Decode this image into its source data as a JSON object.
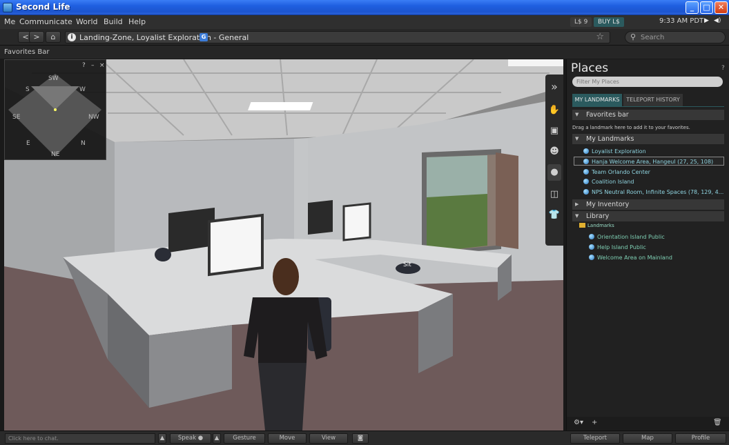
{
  "window": {
    "title": "Second Life",
    "minimize": "_",
    "maximize": "□",
    "close": "✕"
  },
  "menubar": {
    "items": [
      "Me",
      "Communicate",
      "World",
      "Build",
      "Help"
    ],
    "balance": "L$ 9",
    "buy": "BUY L$",
    "time": "9:33 AM PDT",
    "media": "▶",
    "volume": "◀)"
  },
  "navbar": {
    "back": "<",
    "forward": ">",
    "home": "⌂",
    "info": "i",
    "location": "Landing-Zone, Loyalist Exploration - General",
    "region_badge": "G",
    "star": "☆",
    "search_placeholder": "Search"
  },
  "favorites_bar": {
    "label": "Favorites Bar"
  },
  "minimap": {
    "help": "?",
    "minimize": "–",
    "close": "×",
    "directions": {
      "sw": "SW",
      "s": "S",
      "w": "W",
      "se": "SE",
      "nw": "NW",
      "e": "E",
      "n": "N",
      "ne": "NE"
    }
  },
  "scene": {
    "sit_label": "Sit"
  },
  "sidetools": {
    "collapse": "»"
  },
  "places": {
    "title": "Places",
    "help": "?",
    "filter_placeholder": "Filter My Places",
    "tabs": {
      "landmarks": "MY LANDMARKS",
      "history": "TELEPORT HISTORY"
    },
    "favorites": {
      "label": "Favorites bar",
      "arrow": "▼"
    },
    "hint": "Drag a landmark here to add it to your favorites.",
    "my_landmarks": {
      "label": "My Landmarks",
      "arrow": "▼",
      "items": [
        "Loyalist Exploration",
        "Hanja  Welcome Area, Hangeul (27, 25, 108)",
        "Team Orlando Center",
        "Coalition Island",
        "NPS Neutral Room, Infinite Spaces (78, 129, 4..."
      ]
    },
    "inventory": {
      "label": "My Inventory",
      "arrow": "▶"
    },
    "library": {
      "label": "Library",
      "arrow": "▼",
      "folder": "Landmarks",
      "items": [
        "Orientation Island Public",
        "Help Island Public",
        "Welcome Area on Mainland"
      ]
    },
    "footer": {
      "gear": "⚙▾",
      "add": "+",
      "trash": "🗑"
    }
  },
  "bottombar": {
    "chat_placeholder": "Click here to chat.",
    "speak": "Speak",
    "speak_dot": "●",
    "up_arrow": "▲",
    "gesture": "Gesture",
    "move": "Move",
    "view": "View",
    "snapshot": "◙",
    "teleport": "Teleport",
    "map": "Map",
    "profile": "Profile"
  },
  "colors": {
    "accent_tab": "#2b5a5e",
    "landmark_text": "#8fd4e0",
    "library_text": "#7fd0b4",
    "titlebar": "#1f5fe0"
  }
}
